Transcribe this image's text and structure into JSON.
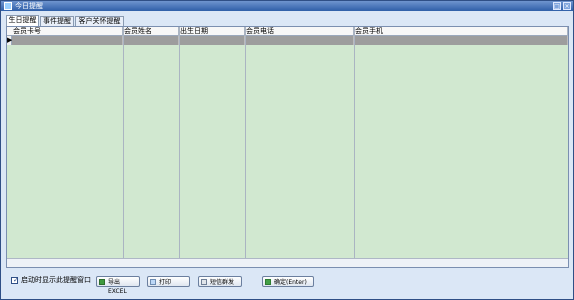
{
  "window": {
    "title": "今日提醒",
    "restore_label": "□",
    "close_label": "×"
  },
  "tabs": [
    {
      "label": "生日提醒"
    },
    {
      "label": "事件提醒"
    },
    {
      "label": "客户关怀提醒"
    }
  ],
  "table": {
    "columns": [
      {
        "label": "会员卡号"
      },
      {
        "label": "会员姓名"
      },
      {
        "label": "出生日期"
      },
      {
        "label": "会员电话"
      },
      {
        "label": "会员手机"
      }
    ],
    "current_row_marker": "▶"
  },
  "footer": {
    "checkbox_label": "启动时显示此提醒窗口",
    "checkbox_checked": true,
    "buttons": {
      "export": "导出EXCEL",
      "print": "打印",
      "sms": "短信群发",
      "confirm": "确定(Enter)"
    }
  },
  "colors": {
    "grid_background": "#d1e8d0",
    "title_bar": "#2f5fa8",
    "selected_row": "#9d9d9d"
  }
}
